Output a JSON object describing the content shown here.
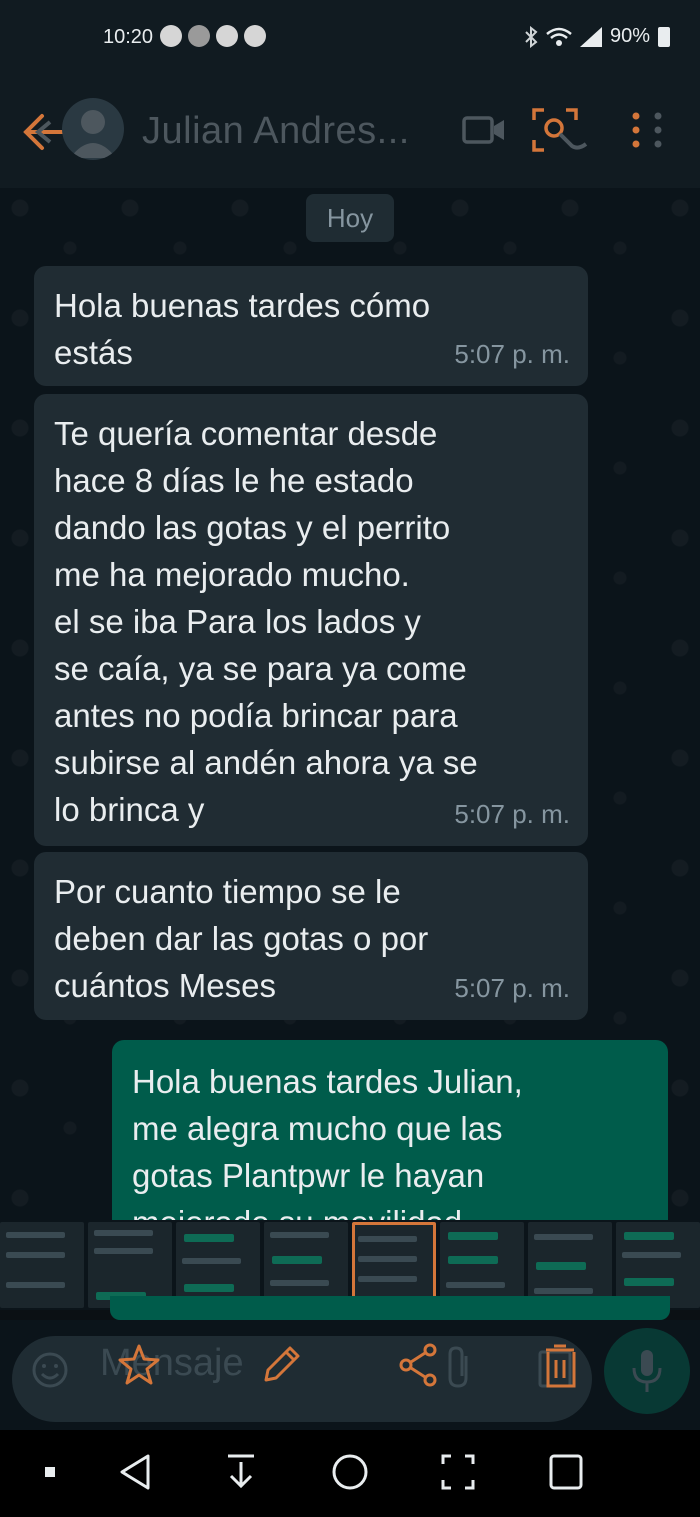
{
  "status": {
    "time": "10:20",
    "battery": "90%"
  },
  "header": {
    "contact_name": "Julian Andres..."
  },
  "chat": {
    "date_label": "Hoy",
    "messages": [
      {
        "direction": "in",
        "text": "Hola buenas tardes cómo\nestás",
        "time": "5:07 p. m."
      },
      {
        "direction": "in",
        "text": "Te quería comentar desde\nhace 8 días le he estado\ndando las gotas  y el perrito\nme ha mejorado mucho.\nel se iba Para los lados y\nse caía, ya se para ya come\nantes no podía brincar para\nsubirse al andén ahora ya se\nlo brinca y",
        "time": "5:07 p. m."
      },
      {
        "direction": "in",
        "text": "Por cuanto tiempo se le\ndeben dar las gotas o por\ncuántos Meses",
        "time": "5:07 p. m."
      },
      {
        "direction": "out",
        "text": "Hola buenas tardes Julian,\nme alegra mucho que las\ngotas Plantpwr le hayan\nmejorado su movilidad",
        "time": ""
      }
    ]
  },
  "composer": {
    "placeholder": "Mensaje"
  },
  "colors": {
    "accent": "#d4763a",
    "bubble_in": "#202c33",
    "bubble_out": "#005c4b",
    "background": "#0b141a"
  }
}
